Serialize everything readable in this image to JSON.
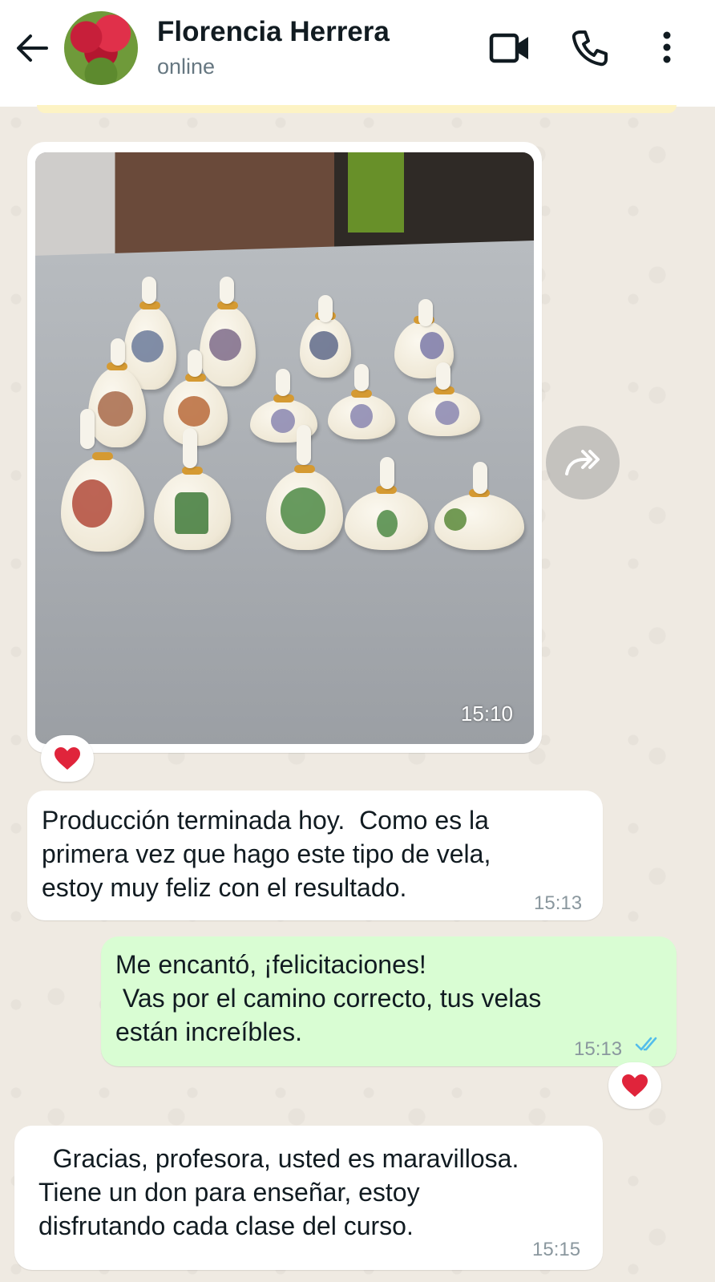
{
  "header": {
    "contact_name": "Florencia Herrera",
    "status": "online"
  },
  "messages": {
    "image_message": {
      "time": "15:10",
      "reaction": "❤"
    },
    "text_1": {
      "lines": "Producción terminada hoy.  Como es la\nprimera vez que hago este tipo de vela,\nestoy muy feliz con el resultado.",
      "time": "15:13"
    },
    "text_2": {
      "lines": "Me encantó, ¡felicitaciones!\n Vas por el camino correcto, tus velas\nestán increíbles.",
      "time": "15:13",
      "reaction": "❤"
    },
    "text_3": {
      "lines": "  Gracias, profesora, usted es maravillosa.\nTiene un don para enseñar, estoy\ndisfrutando cada clase del curso.",
      "time": "15:15"
    }
  },
  "colors": {
    "incoming_bubble": "#ffffff",
    "outgoing_bubble": "#d9fdd3",
    "chat_background": "#efeae2",
    "read_ticks": "#53bdeb",
    "heart": "#e0243b"
  },
  "icons": [
    "back-arrow-icon",
    "video-call-icon",
    "phone-icon",
    "more-options-icon",
    "forward-icon",
    "heart-icon",
    "double-check-icon"
  ]
}
